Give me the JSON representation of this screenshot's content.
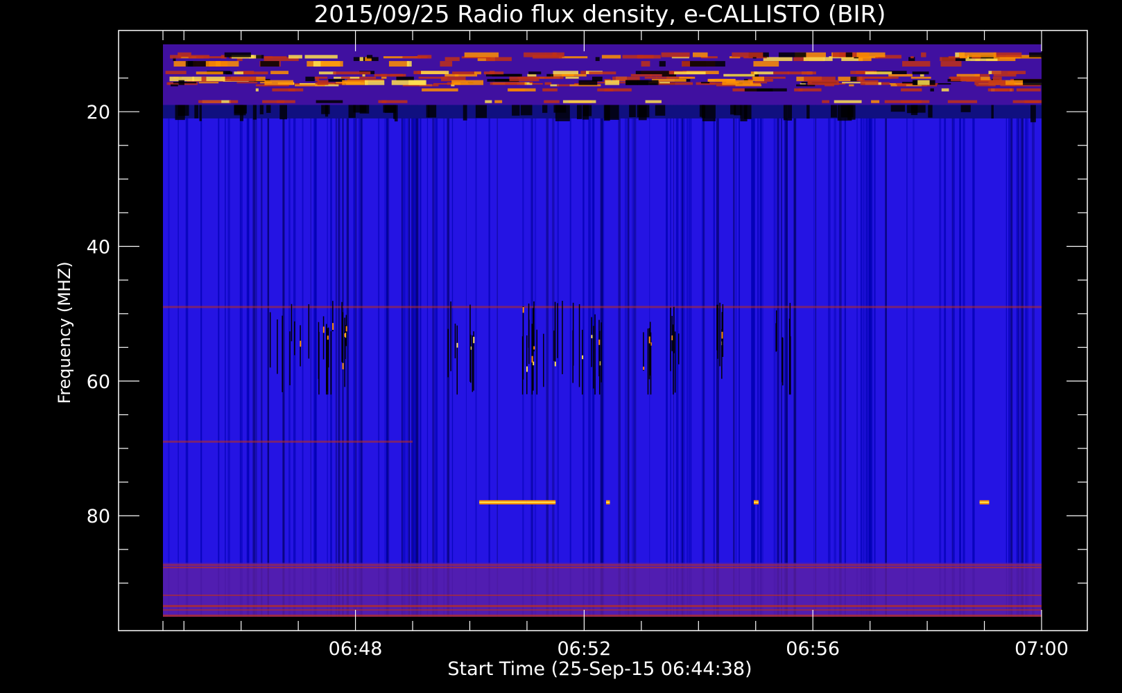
{
  "chart_data": {
    "type": "heatmap",
    "title": "2015/09/25  Radio flux density, e-CALLISTO (BIR)",
    "xlabel": "Start Time (25-Sep-15 06:44:38)",
    "ylabel": "Frequency (MHZ)",
    "x_unit": "UT",
    "x_range": [
      "06:44:38",
      "07:00:00"
    ],
    "ylim": [
      10,
      95
    ],
    "y_inverted": true,
    "x_ticks": [
      "06:48",
      "06:52",
      "06:56",
      "07:00"
    ],
    "y_ticks": [
      20,
      40,
      60,
      80
    ],
    "grid": false,
    "colormap": [
      "#000000",
      "#1010ff",
      "#c03018",
      "#ff9000",
      "#ffe050"
    ],
    "background_color": "#000000",
    "features": [
      {
        "kind": "band",
        "freq_range": [
          10,
          19
        ],
        "time_range": [
          "06:44:38",
          "07:00:00"
        ],
        "intensity": "high"
      },
      {
        "kind": "band",
        "freq_range": [
          19,
          21
        ],
        "time_range": [
          "06:44:38",
          "07:00:00"
        ],
        "intensity": "low"
      },
      {
        "kind": "line",
        "freq": 49,
        "time_range": [
          "06:44:38",
          "07:00:00"
        ],
        "intensity": "medium"
      },
      {
        "kind": "line",
        "freq": 69,
        "time_range": [
          "06:44:38",
          "06:49:00"
        ],
        "intensity": "medium"
      },
      {
        "kind": "band",
        "freq_range": [
          87,
          95
        ],
        "time_range": [
          "06:44:38",
          "07:00:00"
        ],
        "intensity": "medium"
      },
      {
        "kind": "burst",
        "freq_range": [
          47,
          62
        ],
        "time_range": [
          "06:46:30",
          "06:47:50"
        ]
      },
      {
        "kind": "burst",
        "freq_range": [
          48,
          62
        ],
        "time_range": [
          "06:49:35",
          "06:50:05"
        ]
      },
      {
        "kind": "burst",
        "freq_range": [
          48,
          62
        ],
        "time_range": [
          "06:50:50",
          "06:51:40"
        ]
      },
      {
        "kind": "burst",
        "freq_range": [
          48,
          62
        ],
        "time_range": [
          "06:51:45",
          "06:52:20"
        ]
      },
      {
        "kind": "burst",
        "freq_range": [
          47,
          62
        ],
        "time_range": [
          "06:53:00",
          "06:53:40"
        ]
      },
      {
        "kind": "burst",
        "freq_range": [
          48,
          61
        ],
        "time_range": [
          "06:54:15",
          "06:54:25"
        ]
      },
      {
        "kind": "burst",
        "freq_range": [
          48,
          62
        ],
        "time_range": [
          "06:55:15",
          "06:55:40"
        ]
      },
      {
        "kind": "spot",
        "freq": 78,
        "time_range": [
          "06:50:10",
          "06:51:00"
        ]
      },
      {
        "kind": "spot",
        "freq": 78,
        "time_range": [
          "06:51:00",
          "06:51:30"
        ]
      },
      {
        "kind": "spot",
        "freq": 78,
        "time_range": [
          "06:52:23",
          "06:52:27"
        ]
      },
      {
        "kind": "spot",
        "freq": 78,
        "time_range": [
          "06:54:58",
          "06:55:03"
        ]
      },
      {
        "kind": "spot",
        "freq": 78,
        "time_range": [
          "06:58:55",
          "06:59:05"
        ]
      }
    ]
  }
}
